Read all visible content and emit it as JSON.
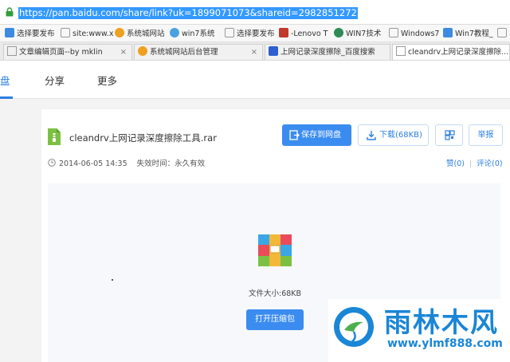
{
  "address_bar": {
    "url": "https://pan.baidu.com/share/link?uk=1899071073&shareid=2982851272"
  },
  "bookmarks": [
    {
      "label": "选择要发布",
      "icon": "bookmark-page-icon",
      "color": "#3c8be0"
    },
    {
      "label": "site:www.x",
      "icon": "page-icon",
      "color": "#999999"
    },
    {
      "label": "系统城网站",
      "icon": "globe-icon",
      "color": "#f0a020"
    },
    {
      "label": "win7系统",
      "icon": "cloud-icon",
      "color": "#4aa3df"
    },
    {
      "label": "选择要发布",
      "icon": "page-icon",
      "color": "#999999"
    },
    {
      "label": "-Lenovo T",
      "icon": "dd-icon",
      "color": "#c0392b"
    },
    {
      "label": "WIN7技术",
      "icon": "leaf-icon",
      "color": "#2e8b57"
    },
    {
      "label": "Windows7",
      "icon": "page-icon",
      "color": "#999999"
    },
    {
      "label": "Win7教程_",
      "icon": "win-icon",
      "color": "#3c8be0"
    },
    {
      "label": "系",
      "icon": "page-icon",
      "color": "#999999"
    }
  ],
  "tabs": [
    {
      "label": "文章编辑页面--by mklin",
      "icon": "page-icon"
    },
    {
      "label": "系统城网站后台管理",
      "icon": "globe-icon"
    },
    {
      "label": "上网记录深度擦除_百度搜索",
      "icon": "paw-icon"
    },
    {
      "label": "cleandrv上网记录深度擦除...",
      "icon": "page-icon"
    }
  ],
  "site_nav": {
    "items": [
      "盘",
      "分享",
      "更多"
    ]
  },
  "file": {
    "name": "cleandrv上网记录深度擦除工具.rar",
    "date": "2014-06-05 14:35",
    "expiry": "失效时间：永久有效",
    "size": "文件大小:68KB"
  },
  "actions": {
    "save": "保存到网盘",
    "download": "下载(68KB)",
    "report": "举报",
    "like": "赞(0)",
    "comment": "评论(0)",
    "open_archive": "打开压缩包"
  },
  "watermark": {
    "title": "雨林木风",
    "url": "www.ylmf888.com"
  },
  "colors": {
    "accent": "#3b8cf0",
    "link": "#2d7fe0",
    "url_highlight": "#3399ff",
    "watermark": "#1a86d6"
  }
}
